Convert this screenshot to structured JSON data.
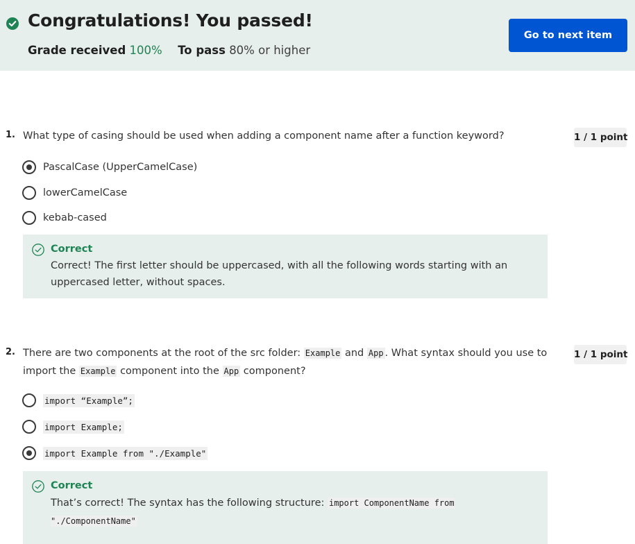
{
  "header": {
    "title": "Congratulations! You passed!",
    "grade_label": "Grade received",
    "grade_value": "100%",
    "to_pass_label": "To pass",
    "to_pass_value": "80% or higher",
    "next_button": "Go to next item",
    "colors": {
      "banner_bg": "#e6efec",
      "button_bg": "#0056d2",
      "success": "#1f8354"
    }
  },
  "questions": [
    {
      "number": "1.",
      "text": "What type of casing should be used when adding a component name after a function keyword?",
      "points": "1 / 1 point",
      "options": [
        {
          "label": "PascalCase (UpperCamelCase)",
          "selected": true
        },
        {
          "label": "lowerCamelCase",
          "selected": false
        },
        {
          "label": "kebab-cased",
          "selected": false
        }
      ],
      "feedback": {
        "title": "Correct",
        "text": "Correct! The first letter should be uppercased, with all the following words starting with an uppercased letter, without spaces."
      }
    },
    {
      "number": "2.",
      "text_parts": {
        "p1": "There are two components at the root of the src folder: ",
        "c1": "Example",
        "p2": " and ",
        "c2": "App",
        "p3": ". What syntax should you use to import the ",
        "c3": "Example",
        "p4": " component into the ",
        "c4": "App",
        "p5": " component?"
      },
      "points": "1 / 1 point",
      "options": [
        {
          "label": "import “Example”;",
          "selected": false
        },
        {
          "label": "import Example;",
          "selected": false
        },
        {
          "label": "import Example from \"./Example\"",
          "selected": true
        }
      ],
      "feedback": {
        "title": "Correct",
        "text": "That’s correct! The syntax has the following structure: ",
        "code": "import ComponentName from \"./ComponentName\""
      }
    }
  ]
}
